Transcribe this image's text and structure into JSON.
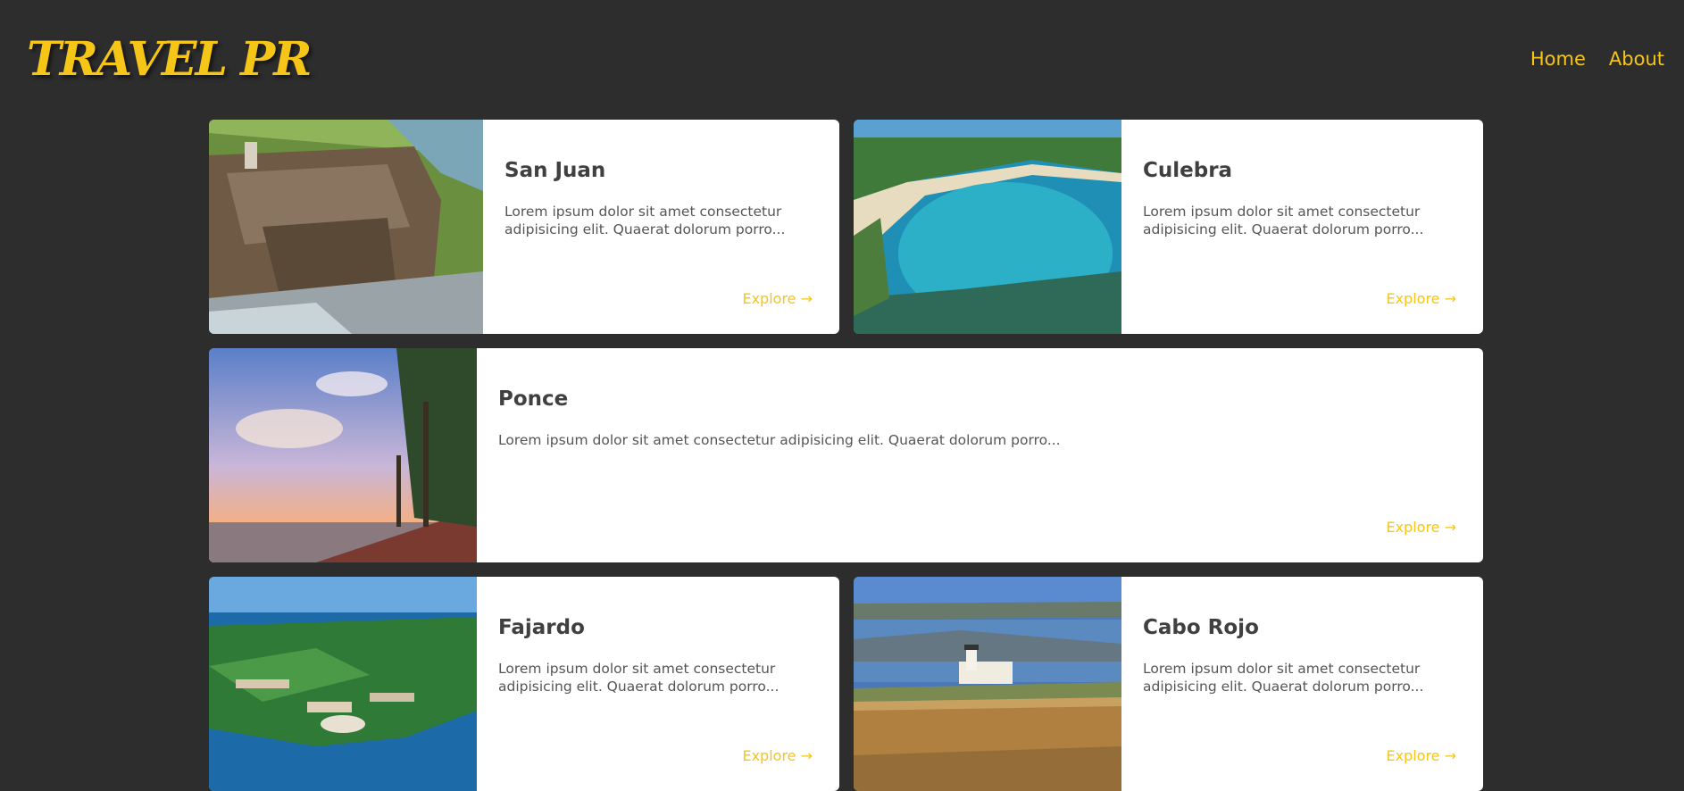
{
  "header": {
    "logo": "TRAVEL PR",
    "nav": [
      "Home",
      "About"
    ]
  },
  "colors": {
    "background": "#2d2d2d",
    "accent": "#f5c518",
    "card": "#ffffff"
  },
  "cards": [
    {
      "title": "San Juan",
      "text": "Lorem ipsum dolor sit amet consectetur adipisicing elit. Quaerat dolorum porro...",
      "link": "Explore →",
      "image": "fortress-cliff-photo"
    },
    {
      "title": "Culebra",
      "text": "Lorem ipsum dolor sit amet consectetur adipisicing elit. Quaerat dolorum porro...",
      "link": "Explore →",
      "image": "turquoise-bay-photo"
    },
    {
      "title": "Ponce",
      "text": "Lorem ipsum dolor sit amet consectetur adipisicing elit. Quaerat dolorum porro...",
      "link": "Explore →",
      "image": "sunset-boardwalk-palms-photo"
    },
    {
      "title": "Fajardo",
      "text": "Lorem ipsum dolor sit amet consectetur adipisicing elit. Quaerat dolorum porro...",
      "link": "Explore →",
      "image": "coastal-resort-aerial-photo"
    },
    {
      "title": "Cabo Rojo",
      "text": "Lorem ipsum dolor sit amet consectetur adipisicing elit. Quaerat dolorum porro...",
      "link": "Explore →",
      "image": "lighthouse-cliff-photo"
    }
  ]
}
